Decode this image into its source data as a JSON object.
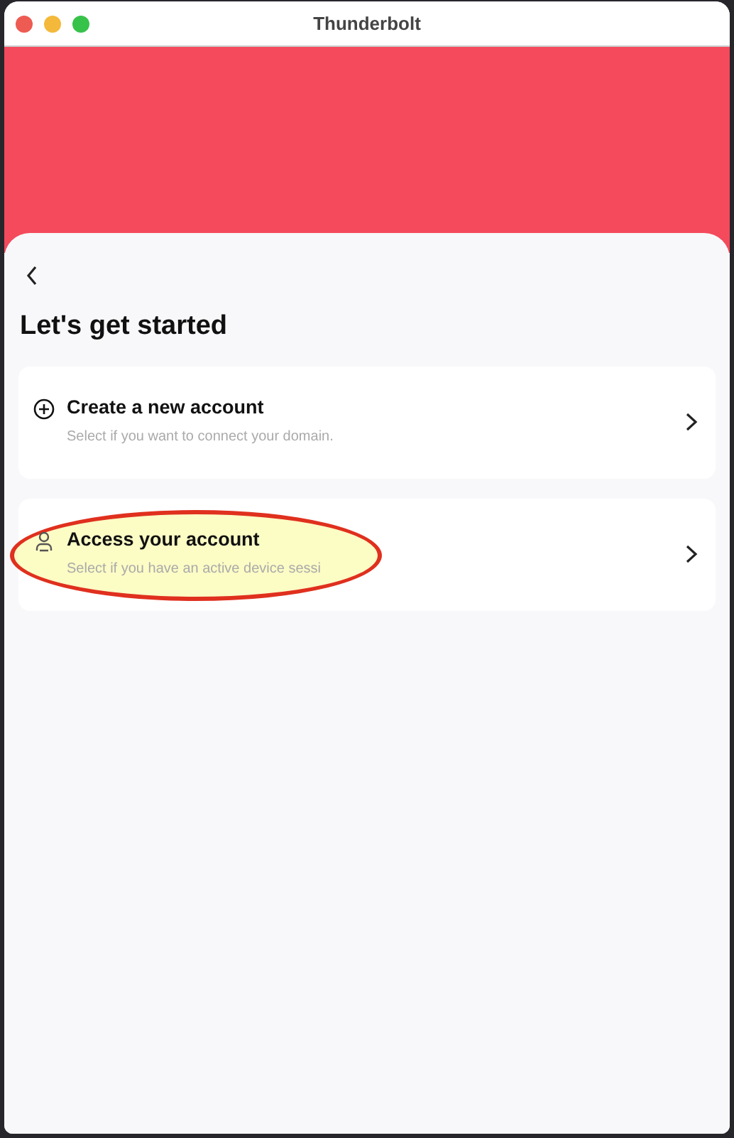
{
  "window": {
    "title": "Thunderbolt"
  },
  "heading": "Let's get started",
  "options": [
    {
      "kind": "create",
      "title": "Create a new account",
      "subtitle": "Select if you want to connect your domain.",
      "highlighted": false
    },
    {
      "kind": "access",
      "title": "Access your account",
      "subtitle": "Select if you have an active device sessi",
      "highlighted": true
    }
  ]
}
